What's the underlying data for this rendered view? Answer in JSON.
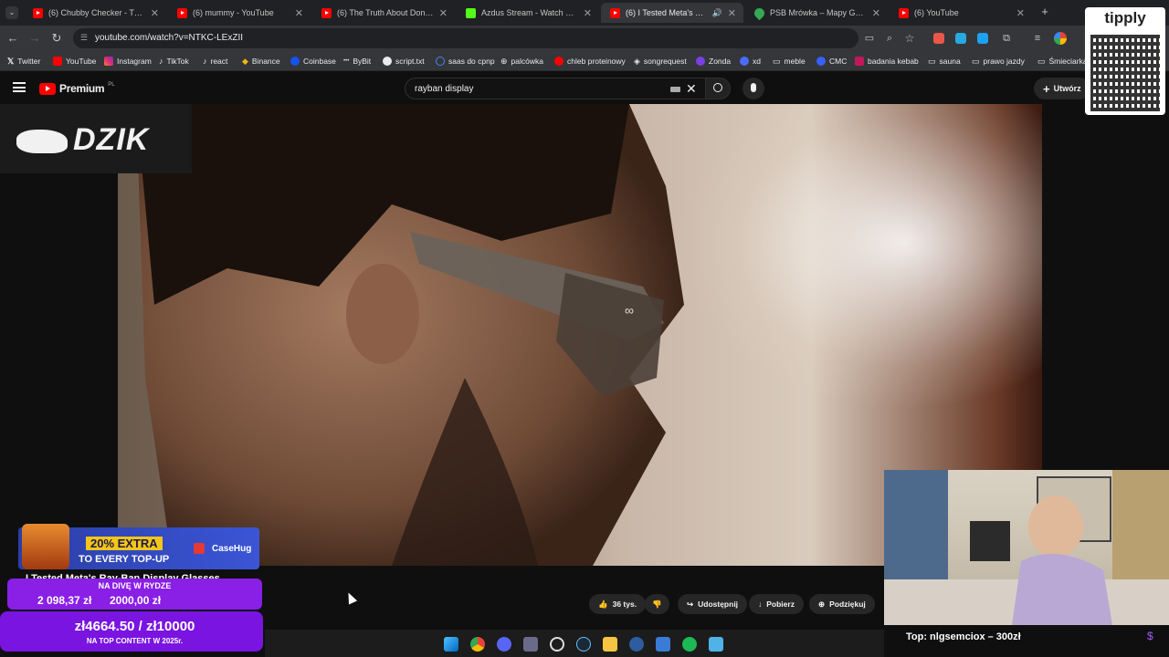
{
  "tabs": [
    {
      "title": "(6) Chubby Checker - The Twist",
      "icon": "youtube-icon"
    },
    {
      "title": "(6) mummy - YouTube",
      "icon": "youtube-icon"
    },
    {
      "title": "(6) The Truth About Donated S",
      "icon": "youtube-icon"
    },
    {
      "title": "Azdus Stream - Watch Live on",
      "icon": "kick-icon"
    },
    {
      "title": "(6) I Tested Meta's Ray-Ban",
      "icon": "youtube-icon",
      "active": true
    },
    {
      "title": "PSB Mrówka – Mapy Google",
      "icon": "maps-icon"
    },
    {
      "title": "(6) YouTube",
      "icon": "youtube-icon"
    }
  ],
  "address": {
    "url": "youtube.com/watch?v=NTKC-LExZII"
  },
  "bookmarks": [
    "Twitter",
    "YouTube",
    "Instagram",
    "TikTok",
    "react",
    "Binance",
    "Coinbase",
    "ByBit",
    "script.txt",
    "saas do cpnp",
    "palcówka",
    "chleb proteinowy",
    "songrequest",
    "Zonda",
    "xd",
    "meble",
    "CMC",
    "badania kebab",
    "sauna",
    "prawo jazdy",
    "Śmieciarka"
  ],
  "youtube": {
    "logo_text": "Premium",
    "logo_superscript": "PL",
    "search_query": "rayban display",
    "create_label": "Utwórz"
  },
  "video": {
    "watermark": "DZIK"
  },
  "actions": {
    "likes": "36 tys.",
    "share": "Udostępnij",
    "download": "Pobierz",
    "thanks": "Podziękuj"
  },
  "overlays": {
    "promo_line1": "20% EXTRA",
    "promo_line2": "TO EVERY TOP-UP",
    "promo_brand": "CaseHug",
    "goal1_title": "NA DIVĘ W RYDZE",
    "goal1_current": "2 098,37 zł",
    "goal1_target": "2000,00 zł",
    "goal2_amount": "zł4664.50 / zł10000",
    "goal2_sub": "NA TOP CONTENT W 2025r.",
    "video_title_partial": "I Tested Meta's Ray-Ban Display Glasses",
    "top_donor": "Top: nlgsemciox – 300zł",
    "tipply_brand": "tipply"
  },
  "colors": {
    "youtube_red": "#ff0000",
    "goal_purple": "#8a1fe6",
    "promo_blue": "#3b55d6",
    "promo_yellow": "#f5c518"
  }
}
